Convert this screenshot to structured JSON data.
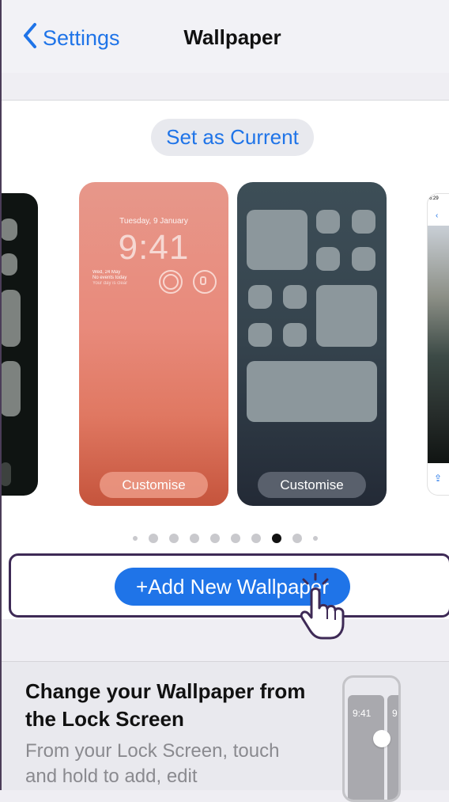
{
  "navbar": {
    "back_label": "Settings",
    "title": "Wallpaper"
  },
  "actions": {
    "set_current_label": "Set as Current",
    "add_new_label": "+Add New Wallpaper"
  },
  "lock_preview": {
    "date": "Tuesday, 9 January",
    "time": "9:41",
    "widget_line1": "Wed, 24 May",
    "widget_line2": "No events today",
    "widget_line3": "Your day is clear",
    "customise_label": "Customise"
  },
  "home_preview": {
    "customise_label": "Customise"
  },
  "right_preview": {
    "status_time": "6:29"
  },
  "pager": {
    "total": 10,
    "active_index": 7
  },
  "info": {
    "title": "Change your Wallpaper from the Lock Screen",
    "body": "From your Lock Screen, touch and hold to add, edit",
    "mini_time": "9:41",
    "mini_time_peek": "9"
  },
  "colors": {
    "accent": "#1f74e8",
    "highlight_border": "#3e2a56",
    "background": "#efeef3"
  }
}
